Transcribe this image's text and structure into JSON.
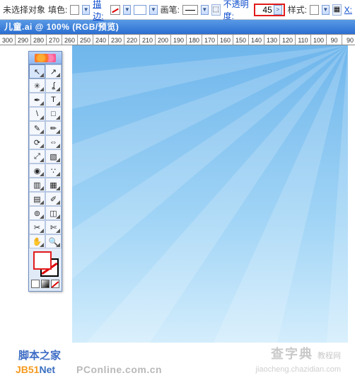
{
  "options": {
    "no_selection": "未选择对象",
    "fill_label": "填色:",
    "stroke_label": "描边:",
    "stroke_weight_placeholder": " ",
    "brush_label": "画笔:",
    "opacity_label": "不透明度:",
    "opacity_value": "45",
    "opacity_arrow": ">",
    "style_label": "样式:",
    "extra_link": "X:"
  },
  "title": "儿童.ai @ 100% (RGB/预览)",
  "ruler": {
    "ticks": [
      "300",
      "290",
      "280",
      "270",
      "260",
      "250",
      "240",
      "230",
      "220",
      "210",
      "200",
      "190",
      "180",
      "170",
      "160",
      "150",
      "140",
      "130",
      "120",
      "110",
      "100",
      "90"
    ],
    "right": "90"
  },
  "toolbox": {
    "tools": [
      {
        "name": "selection-tool",
        "glyph": "↖",
        "sel": true
      },
      {
        "name": "direct-select-tool",
        "glyph": "↗"
      },
      {
        "name": "magic-wand-tool",
        "glyph": "✳"
      },
      {
        "name": "lasso-tool",
        "glyph": "ʆ"
      },
      {
        "name": "pen-tool",
        "glyph": "✒"
      },
      {
        "name": "type-tool",
        "glyph": "T"
      },
      {
        "name": "line-tool",
        "glyph": "\\"
      },
      {
        "name": "rectangle-tool",
        "glyph": "□"
      },
      {
        "name": "paintbrush-tool",
        "glyph": "✎"
      },
      {
        "name": "pencil-tool",
        "glyph": "✏"
      },
      {
        "name": "rotate-tool",
        "glyph": "⟳"
      },
      {
        "name": "reflect-tool",
        "glyph": "⇔"
      },
      {
        "name": "scale-tool",
        "glyph": "⤢"
      },
      {
        "name": "free-transform-tool",
        "glyph": "▧"
      },
      {
        "name": "warp-tool",
        "glyph": "◉"
      },
      {
        "name": "symbol-sprayer-tool",
        "glyph": "∵"
      },
      {
        "name": "graph-tool",
        "glyph": "▥"
      },
      {
        "name": "mesh-tool",
        "glyph": "▦"
      },
      {
        "name": "gradient-tool",
        "glyph": "▤"
      },
      {
        "name": "eyedropper-tool",
        "glyph": "✐"
      },
      {
        "name": "blend-tool",
        "glyph": "⊚"
      },
      {
        "name": "live-paint-tool",
        "glyph": "◫"
      },
      {
        "name": "slice-tool",
        "glyph": "✂"
      },
      {
        "name": "scissors-tool",
        "glyph": "✄"
      },
      {
        "name": "hand-tool",
        "glyph": "✋"
      },
      {
        "name": "zoom-tool",
        "glyph": "🔍"
      }
    ]
  },
  "watermarks": {
    "jb_cn": "脚本之家",
    "jb_en1": "JB51",
    "jb_en2": "Net",
    "pconline": "PConline.com.cn",
    "chazidian": "查字典",
    "chazidian_sub": "教程网",
    "chazidian_url": "jiaocheng.chazidian.com"
  }
}
